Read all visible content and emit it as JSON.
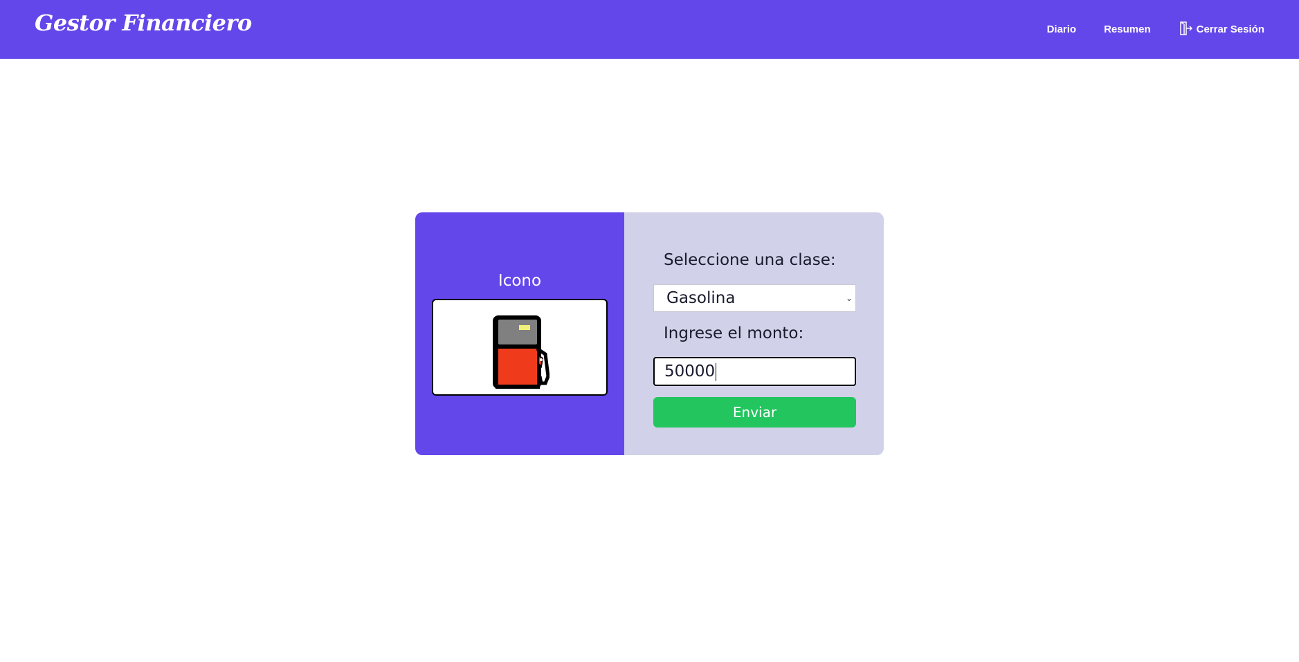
{
  "header": {
    "brand": "Gestor Financiero",
    "nav": {
      "diario": "Diario",
      "resumen": "Resumen",
      "logout": "Cerrar Sesión"
    }
  },
  "icon_panel": {
    "title": "Icono",
    "icon": "gas-pump-icon"
  },
  "form": {
    "class_label": "Seleccione una clase:",
    "class_selected": "Gasolina",
    "amount_label": "Ingrese el monto:",
    "amount_value": "50000",
    "submit_label": "Enviar"
  },
  "colors": {
    "primary": "#6347ea",
    "panel": "#d1d1e9",
    "submit": "#22c55e"
  }
}
